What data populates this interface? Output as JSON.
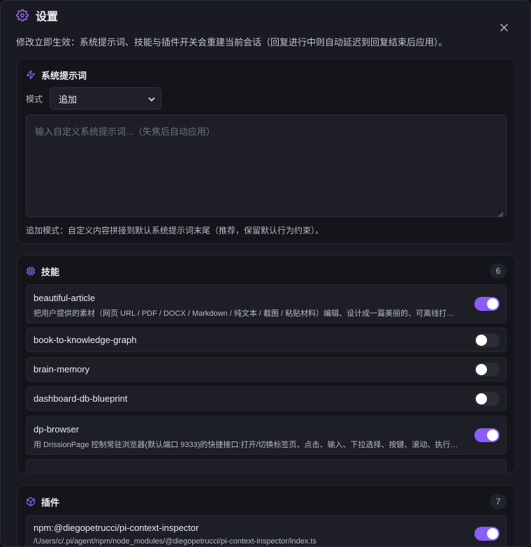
{
  "dialog": {
    "title": "设置",
    "notice": "修改立即生效：系统提示词、技能与插件开关会重建当前会话（回复进行中则自动延迟到回复结束后应用）。"
  },
  "system_prompt": {
    "title": "系统提示词",
    "mode_label": "模式",
    "mode_value": "追加",
    "placeholder": "输入自定义系统提示词...（失焦后自动应用）",
    "hint": "追加模式：自定义内容拼接到默认系统提示词末尾（推荐，保留默认行为约束）。"
  },
  "skills": {
    "title": "技能",
    "count": "6",
    "items": [
      {
        "name": "beautiful-article",
        "desc": "把用户提供的素材（网页 URL / PDF / DOCX / Markdown / 纯文本 / 截图 / 粘贴材料）编辑、设计成一篇美丽的、可离线打开的文章",
        "enabled": true
      },
      {
        "name": "book-to-knowledge-graph",
        "desc": "",
        "enabled": false
      },
      {
        "name": "brain-memory",
        "desc": "",
        "enabled": false
      },
      {
        "name": "dashboard-db-blueprint",
        "desc": "",
        "enabled": false
      },
      {
        "name": "dp-browser",
        "desc": "用 DrissionPage 控制常驻浏览器(默认端口 9333)的快捷接口:打开/切换标签页、点击、输入、下拉选择、按键、滚动、执行脚本",
        "enabled": true
      }
    ]
  },
  "plugins": {
    "title": "插件",
    "count": "7",
    "items": [
      {
        "name": "npm:@diegopetrucci/pi-context-inspector",
        "desc": "/Users/c/.pi/agent/npm/node_modules/@diegopetrucci/pi-context-inspector/index.ts",
        "enabled": true
      }
    ]
  },
  "colors": {
    "accent": "#8b5cf6",
    "icon": "#9b6cf7",
    "background": "#191a22"
  },
  "icons": {
    "header": "gear-icon",
    "close": "close-icon",
    "system_prompt": "bolt-icon",
    "skills": "cpu-chip-icon",
    "plugins": "cube-icon",
    "select": "chevron-down-icon"
  }
}
